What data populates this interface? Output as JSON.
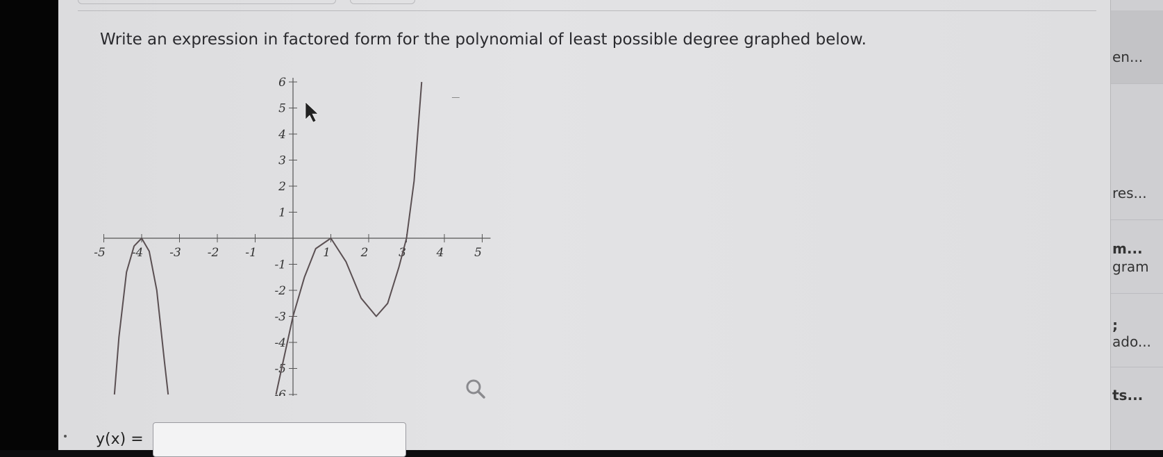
{
  "question": {
    "prompt": "Write an expression in factored form for the polynomial of least possible degree graphed below."
  },
  "chart_data": {
    "type": "line",
    "x_ticks": [
      "-5",
      "-4",
      "-3",
      "-2",
      "-1",
      "1",
      "2",
      "3",
      "4",
      "5"
    ],
    "y_ticks": [
      "6",
      "5",
      "4",
      "3",
      "2",
      "1",
      "-1",
      "-2",
      "-3",
      "-4",
      "-5",
      "-6"
    ],
    "xlim": [
      -5,
      5
    ],
    "ylim": [
      -6,
      6
    ],
    "series": [
      {
        "x": [
          -4.72,
          -4.6,
          -4.4,
          -4.2,
          -4.0,
          -3.8,
          -3.6,
          -3.4,
          -3.3
        ],
        "y": [
          -6,
          -3.8,
          -1.3,
          -0.3,
          0,
          -0.5,
          -2.0,
          -4.7,
          -6
        ]
      },
      {
        "x": [
          -0.45,
          -0.3,
          0,
          0.3,
          0.6,
          1.0,
          1.4,
          1.8,
          2.2,
          2.5,
          2.8,
          3.0,
          3.2,
          3.4
        ],
        "y": [
          -6,
          -5.0,
          -3.0,
          -1.5,
          -0.4,
          0,
          -0.9,
          -2.3,
          -3.0,
          -2.5,
          -1.1,
          0,
          2.2,
          6
        ]
      }
    ],
    "grid": false
  },
  "answer": {
    "label": "y(x) =",
    "value": ""
  },
  "sidebar": {
    "items": [
      {
        "label": "en..."
      },
      {
        "label": "res..."
      },
      {
        "label": "m...",
        "sublabel": "gram"
      },
      {
        "label": ";",
        "sublabel": "ado..."
      },
      {
        "label": "ts..."
      }
    ]
  },
  "icons": {
    "zoom": "magnifier-icon",
    "pointer": "arrow-cursor-icon"
  }
}
